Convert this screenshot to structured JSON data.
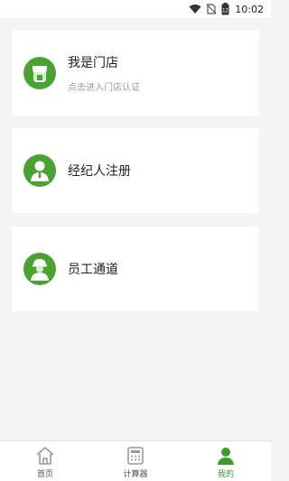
{
  "status_bar": {
    "time": "10:02",
    "battery_level": "12"
  },
  "cards": [
    {
      "title": "我是门店",
      "subtitle": "点击进入门店认证",
      "icon": "store-icon"
    },
    {
      "title": "经纪人注册",
      "icon": "agent-person-icon"
    },
    {
      "title": "员工通道",
      "icon": "employee-helmet-icon"
    }
  ],
  "tabbar": {
    "items": [
      {
        "label": "首页",
        "icon": "home-icon",
        "active": false
      },
      {
        "label": "计算器",
        "icon": "calculator-icon",
        "active": false
      },
      {
        "label": "我的",
        "icon": "profile-icon",
        "active": true
      }
    ]
  },
  "colors": {
    "accent": "#3f9a2b",
    "icon_bg": "#4aa331",
    "background": "#f4f4f4"
  }
}
